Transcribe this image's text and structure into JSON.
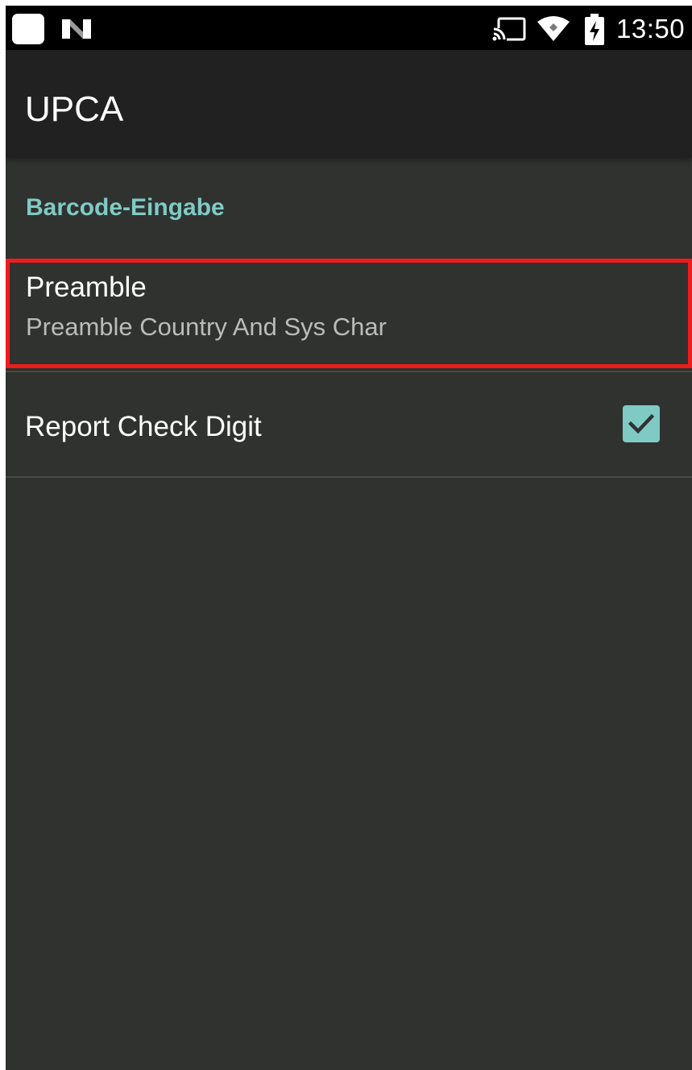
{
  "status_bar": {
    "time": "13:50",
    "notification_icons": [
      "app-icon",
      "n-icon"
    ],
    "system_icons": [
      "cast-icon",
      "wifi-icon",
      "battery-charging-icon"
    ]
  },
  "app_bar": {
    "title": "UPCA"
  },
  "settings": {
    "category_label": "Barcode-Eingabe",
    "items": [
      {
        "title": "Preamble",
        "summary": "Preamble Country And Sys Char",
        "highlighted": true
      },
      {
        "title": "Report Check Digit",
        "checked": true
      }
    ]
  },
  "colors": {
    "accent": "#7fcbc4",
    "background": "#303230",
    "app_bar": "#212121",
    "highlight_border": "#ee1c1c"
  }
}
